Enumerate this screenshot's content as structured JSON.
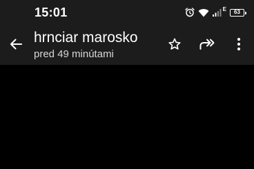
{
  "status_bar": {
    "time": "15:01",
    "network_type": "E",
    "battery_level": "63",
    "icons": [
      "alarm-icon",
      "wifi-icon",
      "signal-icon",
      "battery-icon"
    ]
  },
  "toolbar": {
    "title": "hrnciar marosko",
    "subtitle": "pred 49 minútami",
    "actions": [
      "back-arrow-icon",
      "star-icon",
      "forward-icon",
      "more-vertical-icon"
    ]
  },
  "colors": {
    "bar_background": "#1c1c1d",
    "content_background": "#000000",
    "text": "#ffffff"
  }
}
